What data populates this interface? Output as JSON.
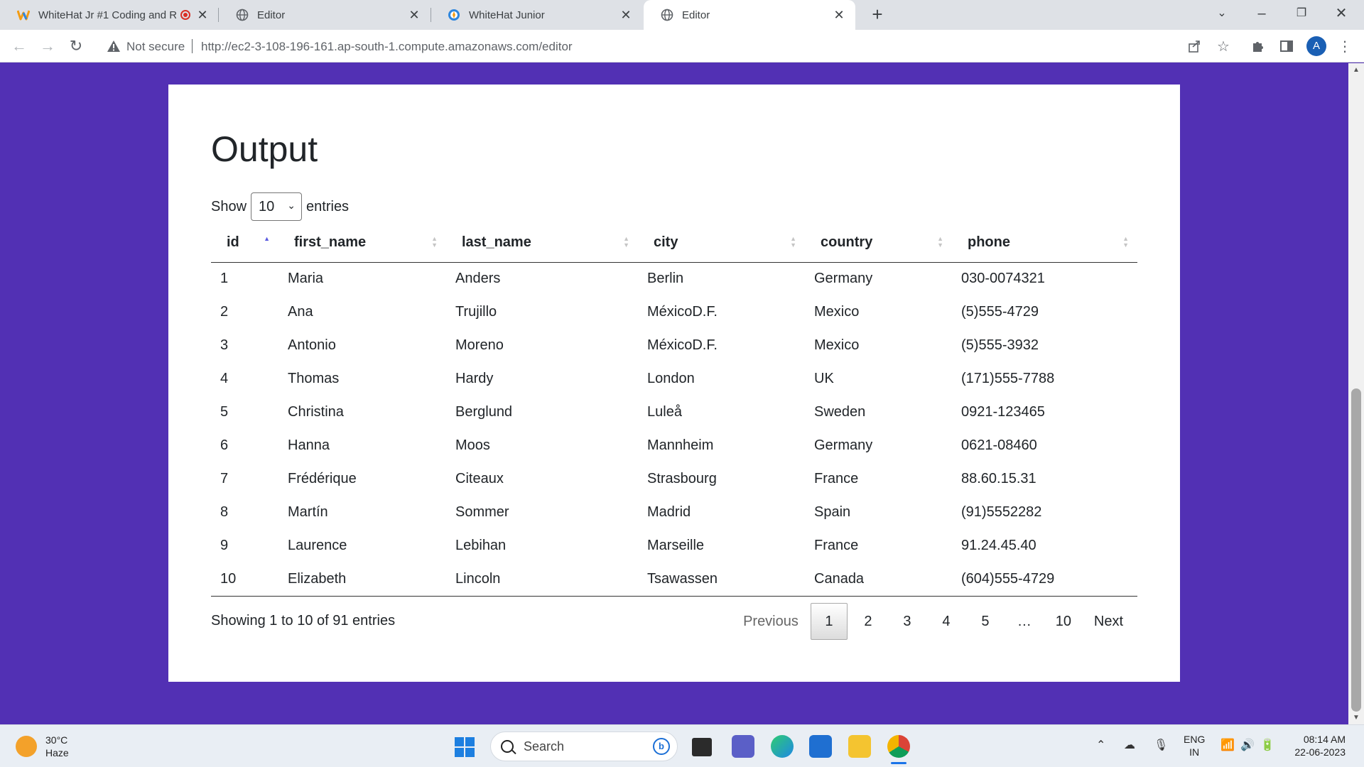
{
  "browser": {
    "tabs": [
      {
        "title": "WhiteHat Jr #1 Coding and R",
        "favicon": "whitehat-logo-icon",
        "recording": true
      },
      {
        "title": "Editor",
        "favicon": "globe-icon"
      },
      {
        "title": "WhiteHat Junior",
        "favicon": "whitehat-compass-icon"
      },
      {
        "title": "Editor",
        "favicon": "globe-icon",
        "active": true
      }
    ],
    "security_label": "Not secure",
    "url": "http://ec2-3-108-196-161.ap-south-1.compute.amazonaws.com/editor",
    "profile_initial": "A"
  },
  "page": {
    "heading": "Output",
    "length_prefix": "Show",
    "length_value": "10",
    "length_suffix": "entries",
    "columns": [
      "id",
      "first_name",
      "last_name",
      "city",
      "country",
      "phone"
    ],
    "rows": [
      [
        "1",
        "Maria",
        "Anders",
        "Berlin",
        "Germany",
        "030-0074321"
      ],
      [
        "2",
        "Ana",
        "Trujillo",
        "MéxicoD.F.",
        "Mexico",
        "(5)555-4729"
      ],
      [
        "3",
        "Antonio",
        "Moreno",
        "MéxicoD.F.",
        "Mexico",
        "(5)555-3932"
      ],
      [
        "4",
        "Thomas",
        "Hardy",
        "London",
        "UK",
        "(171)555-7788"
      ],
      [
        "5",
        "Christina",
        "Berglund",
        "Luleå",
        "Sweden",
        "0921-123465"
      ],
      [
        "6",
        "Hanna",
        "Moos",
        "Mannheim",
        "Germany",
        "0621-08460"
      ],
      [
        "7",
        "Frédérique",
        "Citeaux",
        "Strasbourg",
        "France",
        "88.60.15.31"
      ],
      [
        "8",
        "Martín",
        "Sommer",
        "Madrid",
        "Spain",
        "(91)5552282"
      ],
      [
        "9",
        "Laurence",
        "Lebihan",
        "Marseille",
        "France",
        "91.24.45.40"
      ],
      [
        "10",
        "Elizabeth",
        "Lincoln",
        "Tsawassen",
        "Canada",
        "(604)555-4729"
      ]
    ],
    "info": "Showing 1 to 10 of 91 entries",
    "pagination": {
      "previous": "Previous",
      "pages": [
        "1",
        "2",
        "3",
        "4",
        "5",
        "…",
        "10"
      ],
      "current": "1",
      "next": "Next"
    }
  },
  "taskbar": {
    "temperature": "30°C",
    "weather": "Haze",
    "search_placeholder": "Search",
    "language_line1": "ENG",
    "language_line2": "IN",
    "time": "08:14 AM",
    "date": "22-06-2023"
  },
  "colors": {
    "page_background": "#5230b4",
    "card_background": "#ffffff",
    "sort_active": "#5a5ae0"
  }
}
